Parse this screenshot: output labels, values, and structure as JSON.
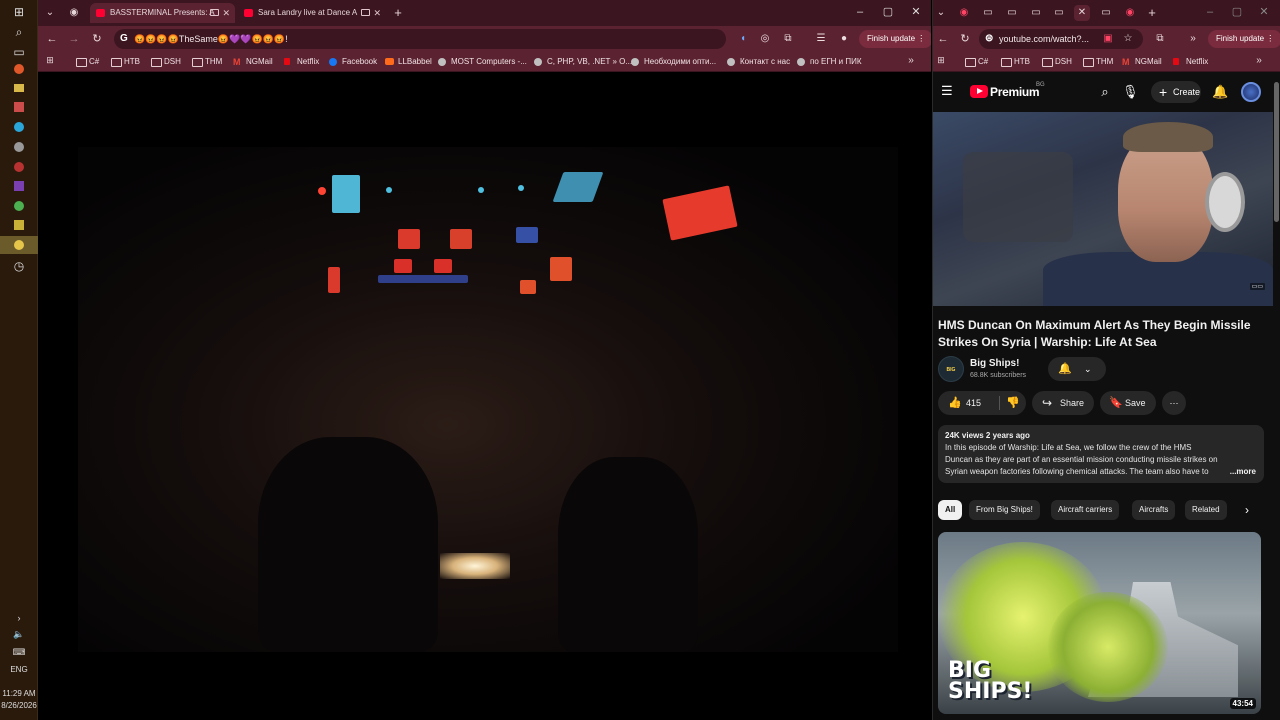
{
  "taskbar": {
    "time": "11:29 AM",
    "date": "8/26/2026",
    "lang": "ENG"
  },
  "left_window": {
    "tabs": [
      {
        "title": "BASSTERMINAL Presents: A"
      },
      {
        "title": "Sara Landry live at Dance A"
      }
    ],
    "omnibox": "😡😡😡😡TheSame😡💜💜😡😡😡!",
    "finish_update": "Finish update",
    "bookmarks": [
      "C#",
      "НТВ",
      "DSH",
      "THM",
      "NGMail",
      "Netflix",
      "Facebook",
      "LLBabbel",
      "MOST Computers -...",
      "C, PHP, VB, .NET » O...",
      "Необходими опти...",
      "Контакт с нас",
      "по ЕГН и ПИК"
    ]
  },
  "right_window": {
    "omnibox": "youtube.com/watch?...",
    "finish_update": "Finish update",
    "bookmarks": [
      "C#",
      "НТВ",
      "DSH",
      "THM",
      "NGMail",
      "Netflix"
    ]
  },
  "youtube": {
    "brand": "Premium",
    "region": "BG",
    "create_label": "Create",
    "video_title": "HMS Duncan On Maximum Alert As They Begin Missile Strikes On Syria | Warship: Life At Sea",
    "channel_name": "Big Ships!",
    "channel_avatar_text": "BIG SHIPS",
    "subscribers": "68.8K subscribers",
    "likes": "415",
    "share_label": "Share",
    "save_label": "Save",
    "description_meta": "24K views  2 years ago",
    "description_text": "In this episode of Warship: Life at Sea, we follow the crew of the HMS Duncan as they are part of an essential mission conducting missile strikes on Syrian weapon factories following chemical attacks.  The team also have to de",
    "description_more": "...more",
    "chips": [
      "All",
      "From Big Ships!",
      "Aircraft carriers",
      "Aircrafts",
      "Related"
    ],
    "rec_thumb_text_1": "BIG",
    "rec_thumb_text_2": "SHIPS!",
    "rec_duration": "43:54"
  }
}
